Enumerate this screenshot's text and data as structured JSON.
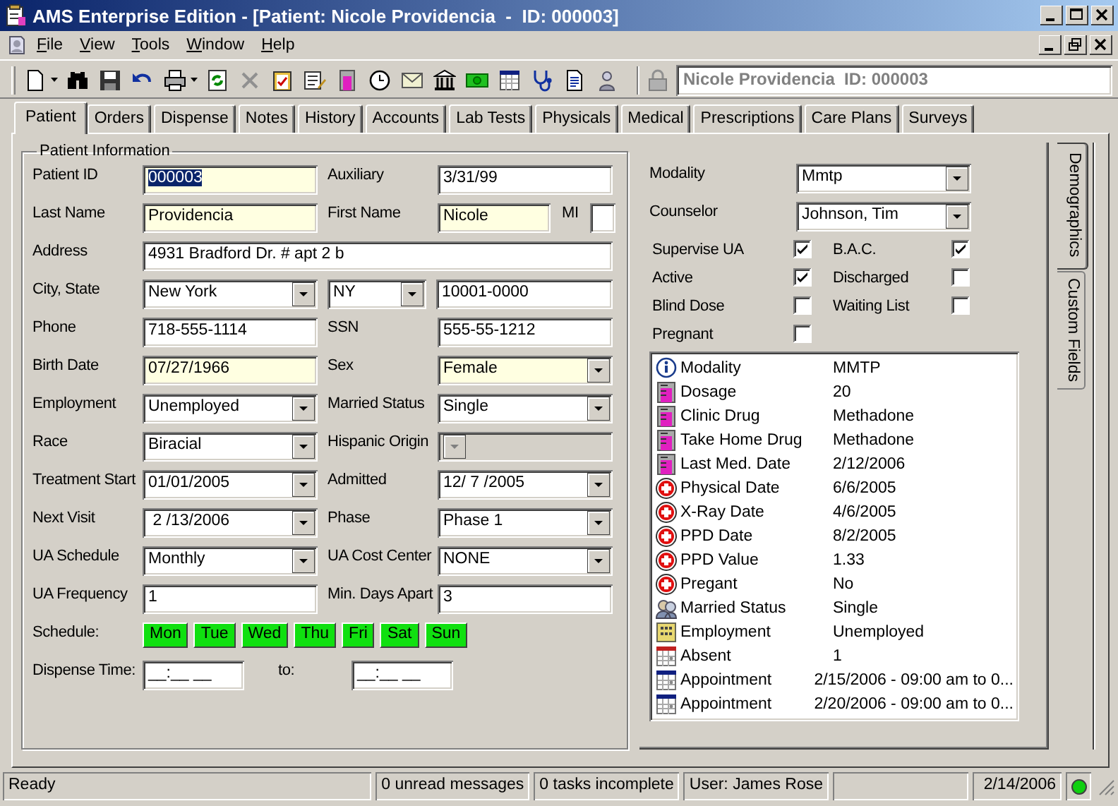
{
  "window": {
    "title": "AMS Enterprise Edition - [Patient: Nicole Providencia  -  ID: 000003]"
  },
  "menu": [
    "File",
    "View",
    "Tools",
    "Window",
    "Help"
  ],
  "toolbar": {
    "patient_field": {
      "value": "Nicole Providencia  ID: 000003",
      "disabled": true
    }
  },
  "tabs": [
    {
      "label": "Patient",
      "selected": true
    },
    {
      "label": "Orders",
      "selected": false
    },
    {
      "label": "Dispense",
      "selected": false
    },
    {
      "label": "Notes",
      "selected": false
    },
    {
      "label": "History",
      "selected": false
    },
    {
      "label": "Accounts",
      "selected": false
    },
    {
      "label": "Lab Tests",
      "selected": false
    },
    {
      "label": "Physicals",
      "selected": false
    },
    {
      "label": "Medical",
      "selected": false
    },
    {
      "label": "Prescriptions",
      "selected": false
    },
    {
      "label": "Care Plans",
      "selected": false
    },
    {
      "label": "Surveys",
      "selected": false
    }
  ],
  "patient_information": {
    "title": "Patient Information",
    "rows": [
      {
        "kind": "pair",
        "fields": [
          {
            "label": "Patient ID",
            "control": {
              "kind": "text",
              "value": "000003",
              "required": true,
              "text_selected": true
            }
          },
          {
            "label": "Auxiliary",
            "control": {
              "kind": "text",
              "value": "3/31/99",
              "required": false
            }
          }
        ]
      },
      {
        "kind": "name",
        "fields": [
          {
            "label": "Last Name",
            "control": {
              "kind": "text",
              "value": "Providencia",
              "required": true
            }
          },
          {
            "label": "First Name",
            "control": {
              "kind": "text",
              "value": "Nicole",
              "required": true
            }
          },
          {
            "label": "MI",
            "control": {
              "kind": "text",
              "required": false
            }
          }
        ]
      },
      {
        "kind": "wide",
        "fields": [
          {
            "label": "Address",
            "control": {
              "kind": "text",
              "value": "4931 Bradford Dr. # apt 2 b",
              "required": false
            }
          }
        ]
      },
      {
        "kind": "city",
        "fields": [
          {
            "label": "City, State",
            "control": {
              "kind": "combo",
              "value": "New York",
              "required": false
            }
          },
          {
            "control": {
              "kind": "combo",
              "value": "NY",
              "required": false
            }
          },
          {
            "control": {
              "kind": "text",
              "value": "10001-0000",
              "required": false
            }
          }
        ]
      },
      {
        "kind": "pair",
        "fields": [
          {
            "label": "Phone",
            "control": {
              "kind": "text",
              "value": "718-555-1114",
              "required": false
            }
          },
          {
            "label": "SSN",
            "control": {
              "kind": "text",
              "value": "555-55-1212",
              "required": false
            }
          }
        ]
      },
      {
        "kind": "pair",
        "fields": [
          {
            "label": "Birth Date",
            "control": {
              "kind": "text",
              "value": "07/27/1966",
              "required": true
            }
          },
          {
            "label": "Sex",
            "control": {
              "kind": "combo",
              "value": "Female",
              "required": true
            }
          }
        ]
      },
      {
        "kind": "pair",
        "fields": [
          {
            "label": "Employment",
            "control": {
              "kind": "combo",
              "value": "Unemployed",
              "required": false
            }
          },
          {
            "label": "Married Status",
            "control": {
              "kind": "combo",
              "value": "Single",
              "required": false
            }
          }
        ]
      },
      {
        "kind": "pair",
        "fields": [
          {
            "label": "Race",
            "control": {
              "kind": "combo",
              "value": "Biracial",
              "required": false
            }
          },
          {
            "label": "Hispanic Origin",
            "control": {
              "kind": "combo",
              "required": false,
              "disabled": true
            }
          }
        ]
      },
      {
        "kind": "pair",
        "fields": [
          {
            "label": "Treatment Start",
            "control": {
              "kind": "combo",
              "value": "01/01/2005",
              "required": false
            }
          },
          {
            "label": "Admitted",
            "control": {
              "kind": "combo",
              "value": "12/ 7 /2005",
              "required": false
            }
          }
        ]
      },
      {
        "kind": "pair",
        "fields": [
          {
            "label": "Next Visit",
            "control": {
              "kind": "combo",
              "value": " 2 /13/2006",
              "required": false
            }
          },
          {
            "label": "Phase",
            "control": {
              "kind": "combo",
              "value": "Phase 1",
              "required": false
            }
          }
        ]
      },
      {
        "kind": "pair",
        "fields": [
          {
            "label": "UA Schedule",
            "control": {
              "kind": "combo",
              "value": "Monthly",
              "required": false
            }
          },
          {
            "label": "UA Cost Center",
            "control": {
              "kind": "combo",
              "value": "NONE",
              "required": false
            }
          }
        ]
      },
      {
        "kind": "pair",
        "fields": [
          {
            "label": "UA Frequency",
            "control": {
              "kind": "text",
              "value": "1",
              "required": false
            }
          },
          {
            "label": "Min. Days Apart",
            "control": {
              "kind": "text",
              "value": "3",
              "required": false
            }
          }
        ]
      },
      {
        "kind": "days",
        "label": "Schedule:",
        "days": [
          {
            "label": "Mon",
            "on": true
          },
          {
            "label": "Tue",
            "on": true
          },
          {
            "label": "Wed",
            "on": true
          },
          {
            "label": "Thu",
            "on": true
          },
          {
            "label": "Fri",
            "on": true
          },
          {
            "label": "Sat",
            "on": true
          },
          {
            "label": "Sun",
            "on": true
          }
        ]
      },
      {
        "kind": "range",
        "fields": [
          {
            "label": "Dispense Time:",
            "control": {
              "kind": "text",
              "value": "__:__ __",
              "required": false
            }
          },
          {
            "label": "to:",
            "control": {
              "kind": "text",
              "value": "__:__ __",
              "required": false
            }
          }
        ]
      }
    ]
  },
  "side": {
    "combos": [
      {
        "label": "Modality",
        "value": "Mmtp"
      },
      {
        "label": "Counselor",
        "value": "Johnson, Tim"
      }
    ],
    "checks": [
      {
        "label": "Supervise UA",
        "checked": true
      },
      {
        "label": "B.A.C.",
        "checked": true
      },
      {
        "label": "Active",
        "checked": true
      },
      {
        "label": "Discharged",
        "checked": false
      },
      {
        "label": "Blind Dose",
        "checked": false
      },
      {
        "label": "Waiting List",
        "checked": false
      },
      {
        "label": "Pregnant",
        "checked": false
      }
    ],
    "summary": [
      {
        "kind": "info",
        "label": "Modality",
        "value": "MMTP"
      },
      {
        "kind": "beaker",
        "label": "Dosage",
        "value": "20"
      },
      {
        "kind": "beaker",
        "label": "Clinic Drug",
        "value": "Methadone"
      },
      {
        "kind": "beaker",
        "label": "Take Home Drug",
        "value": "Methadone"
      },
      {
        "kind": "beaker",
        "label": "Last Med. Date",
        "value": "2/12/2006"
      },
      {
        "kind": "medical",
        "label": "Physical Date",
        "value": "6/6/2005"
      },
      {
        "kind": "medical",
        "label": "X-Ray Date",
        "value": "4/6/2005"
      },
      {
        "kind": "medical",
        "label": "PPD Date",
        "value": "8/2/2005"
      },
      {
        "kind": "medical",
        "label": "PPD Value",
        "value": "1.33"
      },
      {
        "kind": "medical",
        "label": "Pregant",
        "value": "No"
      },
      {
        "kind": "people",
        "label": "Married Status",
        "value": "Single"
      },
      {
        "kind": "building",
        "label": "Employment",
        "value": "Unemployed"
      },
      {
        "kind": "absence",
        "label": "Absent",
        "value": "1"
      },
      {
        "kind": "appointment",
        "label": "Appointment",
        "value": "2/15/2006 - 09:00 am to 0..."
      },
      {
        "kind": "appointment",
        "label": "Appointment",
        "value": "2/20/2006 - 09:00 am to 0..."
      }
    ]
  },
  "side_tabs": [
    {
      "label": "Demographics",
      "selected": true
    },
    {
      "label": "Custom Fields",
      "selected": false
    }
  ],
  "status_bar": {
    "panes": [
      "Ready",
      "0 unread messages",
      "0 tasks incomplete",
      "User: James Rose"
    ],
    "date": "2/14/2006",
    "online": true
  }
}
